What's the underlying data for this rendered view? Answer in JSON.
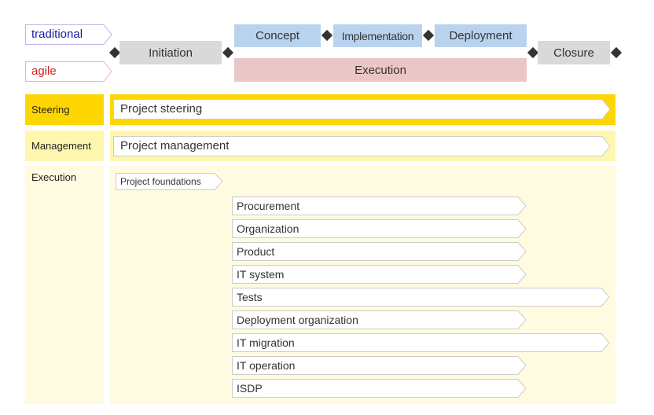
{
  "legend": {
    "traditional": "traditional",
    "agile": "agile",
    "traditional_color": "#1a1aa8",
    "agile_color": "#d42020"
  },
  "phases": {
    "initiation": "Initiation",
    "concept": "Concept",
    "implementation": "Implementation",
    "deployment": "Deployment",
    "execution": "Execution",
    "closure": "Closure"
  },
  "bands": {
    "steering": "Steering",
    "management": "Management",
    "execution": "Execution"
  },
  "bars": {
    "project_steering": "Project steering",
    "project_management": "Project management",
    "project_foundations": "Project foundations",
    "procurement": "Procurement",
    "organization": "Organization",
    "product": "Product",
    "it_system": "IT system",
    "tests": "Tests",
    "deployment_organization": "Deployment organization",
    "it_migration": "IT migration",
    "it_operation": "IT operation",
    "isdp": "ISDP"
  },
  "colors": {
    "steering_band": "#ffd700",
    "management_band": "#fff7b0",
    "execution_band": "#fffbe0",
    "traditional_phase": "#b9d3ee",
    "agile_phase": "#ebc6c6",
    "gray_phase": "#d9d9d9"
  }
}
